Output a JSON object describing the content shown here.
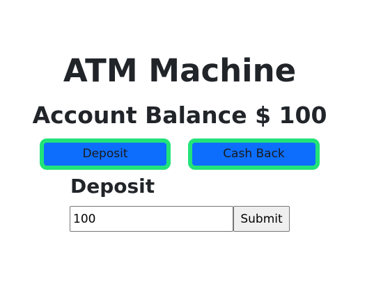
{
  "app": {
    "title": "ATM Machine"
  },
  "balance": {
    "label": "Account Balance $ 100"
  },
  "actions": {
    "deposit_label": "Deposit",
    "cashback_label": "Cash Back"
  },
  "form": {
    "heading": "Deposit",
    "amount_value": "100",
    "submit_label": "Submit"
  },
  "colors": {
    "button_fill": "#0d6efd",
    "button_border": "#22e37a"
  }
}
